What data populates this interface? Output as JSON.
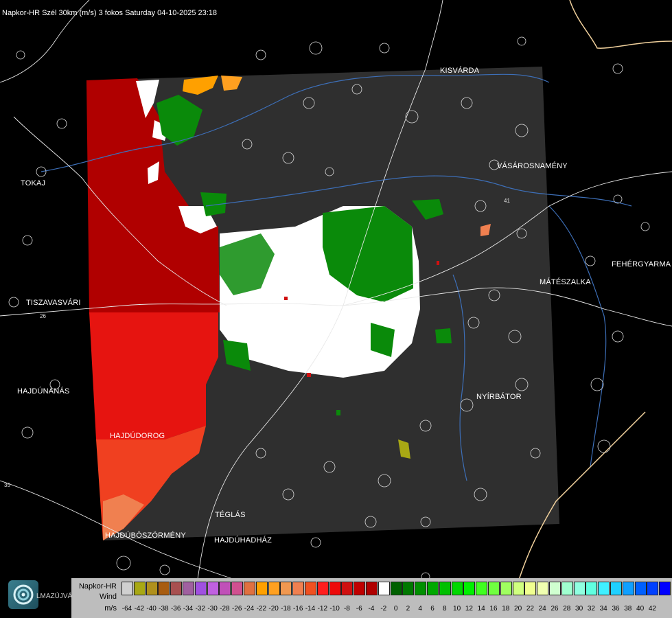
{
  "header": {
    "title": "Napkor-HR Szél 30km (m/s) 3 fokos Saturday 04-10-2025 23:18"
  },
  "cities": [
    {
      "name": "KISVÁRDA",
      "id": "kisvarda"
    },
    {
      "name": "VÁSÁROSNAMÉNY",
      "id": "vasarosnameny"
    },
    {
      "name": "TOKAJ",
      "id": "tokaj"
    },
    {
      "name": "FEHÉRGYARMA",
      "id": "fehergyarmat"
    },
    {
      "name": "MÁTÉSZALKA",
      "id": "mateszalka"
    },
    {
      "name": "TISZAVASVÁRI",
      "id": "tiszavasvari"
    },
    {
      "name": "HAJDÚNÁNÁS",
      "id": "hajdunanas"
    },
    {
      "name": "NYÍRBÁTOR",
      "id": "nyirbator"
    },
    {
      "name": "HAJDÚDOROG",
      "id": "hajdudorog"
    },
    {
      "name": "TÉGLÁS",
      "id": "teglas"
    },
    {
      "name": "HAJDÚBÖSZÖRMÉNY",
      "id": "hajduboszormeny"
    },
    {
      "name": "HAJDÚHADHÁZ",
      "id": "hajduhadhaz"
    }
  ],
  "road_numbers": [
    "26",
    "35",
    "41"
  ],
  "legend": {
    "title_line1": "Napkor-HR",
    "title_line2": "Wind",
    "title_line3": "m/s",
    "swatch_colors": [
      "#d0d0d0",
      "#a8a814",
      "#b0901c",
      "#a85c10",
      "#a85050",
      "#a060a0",
      "#a050e0",
      "#c060e0",
      "#c050b8",
      "#d05090",
      "#e07040",
      "#ffa000",
      "#ffa020",
      "#f09850",
      "#f08050",
      "#f05020",
      "#ff1e1e",
      "#ee0a0a",
      "#d01010",
      "#c00000",
      "#b00000",
      "#ffffff",
      "#006000",
      "#007800",
      "#009000",
      "#00a800",
      "#00c000",
      "#00d800",
      "#00f000",
      "#40ff20",
      "#70ff40",
      "#a0ff60",
      "#d0ff80",
      "#f0ff90",
      "#f0ffb0",
      "#d0ffd0",
      "#a0ffd0",
      "#90ffe0",
      "#60ffe0",
      "#40f0ff",
      "#20d0ff",
      "#10a0ff",
      "#0060ff",
      "#0040ff",
      "#0000ff"
    ],
    "labels": [
      "-64",
      "-42",
      "-40",
      "-38",
      "-36",
      "-34",
      "-32",
      "-30",
      "-28",
      "-26",
      "-24",
      "-22",
      "-20",
      "-18",
      "-16",
      "-14",
      "-12",
      "-10",
      "-8",
      "-6",
      "-4",
      "-2",
      "0",
      "2",
      "4",
      "6",
      "8",
      "10",
      "12",
      "14",
      "16",
      "18",
      "20",
      "22",
      "24",
      "26",
      "28",
      "30",
      "32",
      "34",
      "36",
      "38",
      "40",
      "42"
    ]
  },
  "logo_text": "LMAZÚJVÁR"
}
